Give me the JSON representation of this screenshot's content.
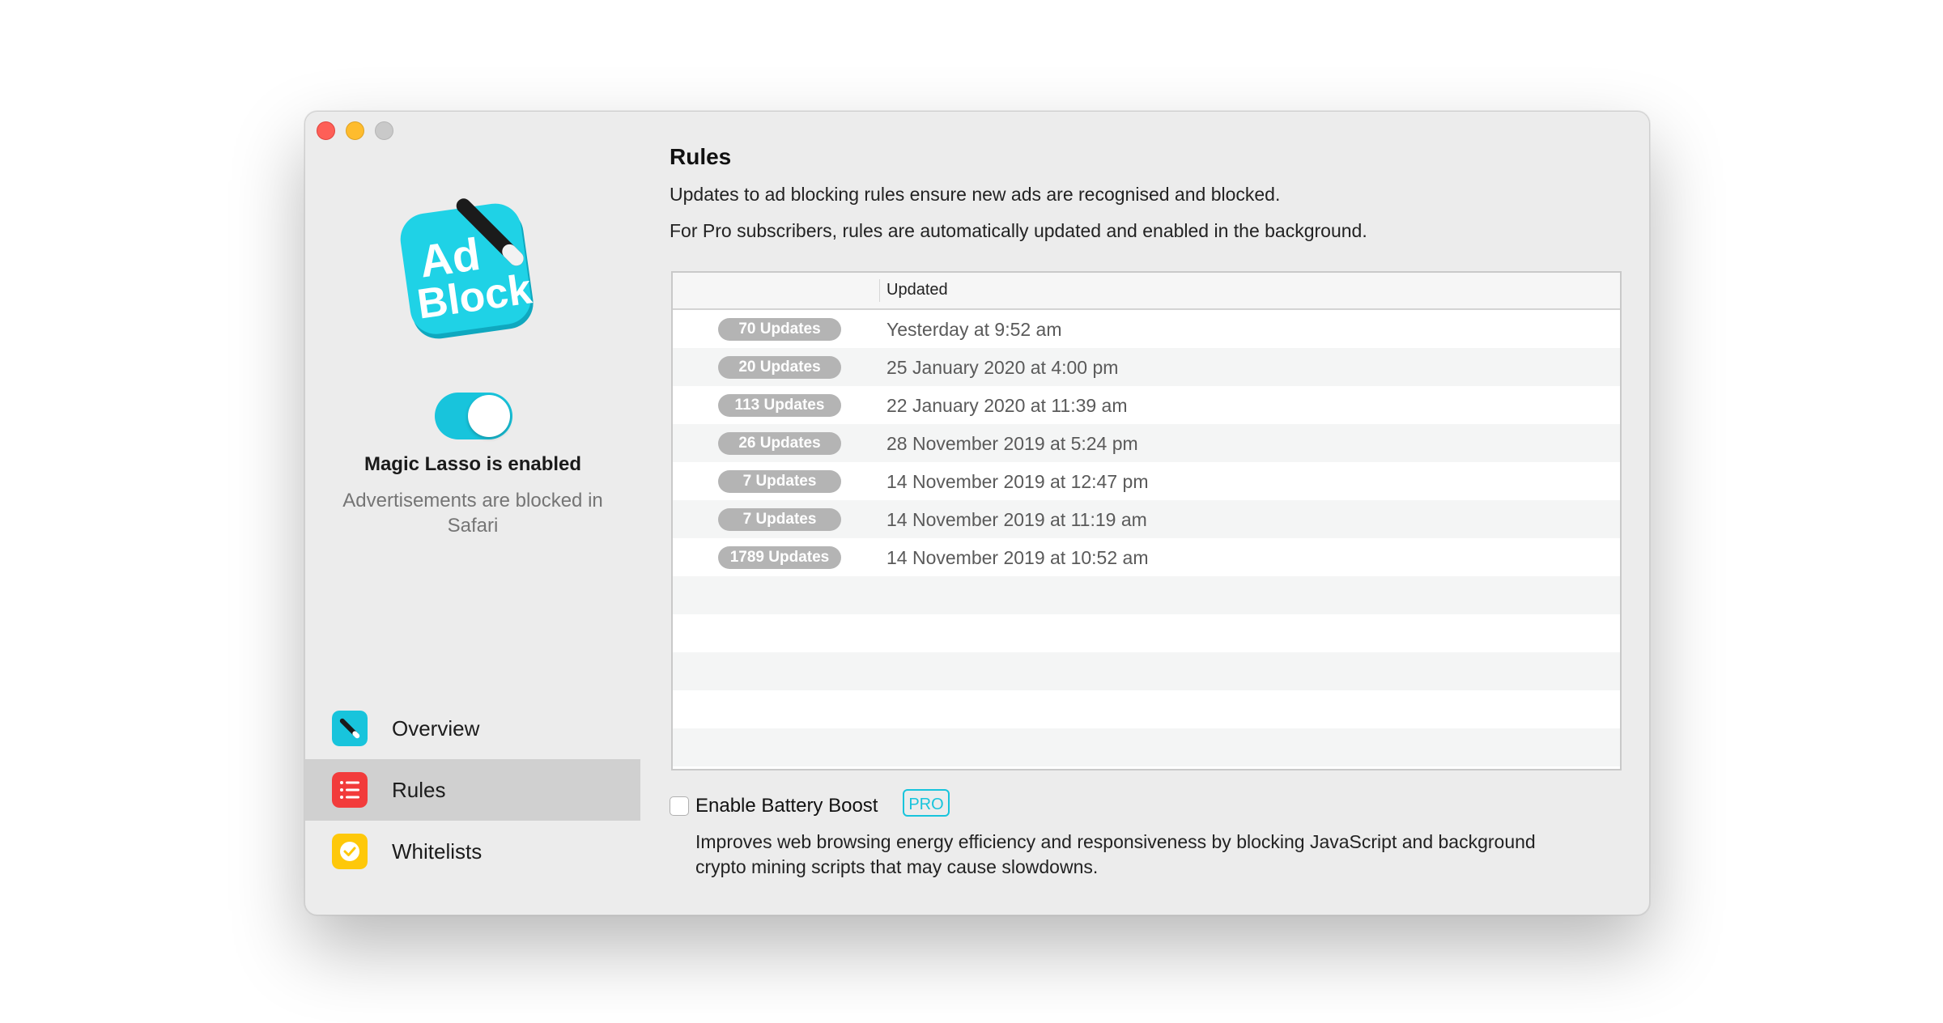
{
  "window": {
    "controls": [
      "close",
      "minimize",
      "zoom"
    ]
  },
  "sidebar": {
    "app_icon": {
      "name": "adblock-app-icon",
      "text_line1": "Ad",
      "text_line2": "Block"
    },
    "toggle": {
      "state": "on"
    },
    "status_title": "Magic Lasso is enabled",
    "status_subtitle": "Advertisements are blocked in Safari",
    "nav": [
      {
        "label": "Overview",
        "icon": "wand-icon",
        "color": "#18c4dc",
        "selected": false
      },
      {
        "label": "Rules",
        "icon": "list-icon",
        "color": "#f23b3b",
        "selected": true
      },
      {
        "label": "Whitelists",
        "icon": "checkmark-icon",
        "color": "#fec80a",
        "selected": false
      }
    ]
  },
  "main": {
    "title": "Rules",
    "desc1": "Updates to ad blocking rules ensure new ads are recognised and blocked.",
    "desc2": "For Pro subscribers, rules are automatically updated and enabled in the background.",
    "table": {
      "columns": [
        "",
        "Updated"
      ],
      "rows": [
        {
          "badge": "70 Updates",
          "date": "Yesterday at 9:52 am"
        },
        {
          "badge": "20 Updates",
          "date": "25 January 2020 at 4:00 pm"
        },
        {
          "badge": "113 Updates",
          "date": "22 January 2020 at 11:39 am"
        },
        {
          "badge": "26 Updates",
          "date": "28 November 2019 at 5:24 pm"
        },
        {
          "badge": "7 Updates",
          "date": "14 November 2019 at 12:47 pm"
        },
        {
          "badge": "7 Updates",
          "date": "14 November 2019 at 11:19 am"
        },
        {
          "badge": "1789 Updates",
          "date": "14 November 2019 at 10:52 am"
        }
      ]
    },
    "battery": {
      "checked": false,
      "label": "Enable Battery Boost",
      "pro_badge": "PRO",
      "description": "Improves web browsing energy efficiency and responsiveness by blocking JavaScript and background crypto mining scripts that may cause slowdowns."
    }
  },
  "colors": {
    "accent": "#18c4dc",
    "close": "#fe5f57",
    "minimize": "#febc2e",
    "zoom_disabled": "#c9c9c9",
    "badge_grey": "#b4b4b4"
  }
}
